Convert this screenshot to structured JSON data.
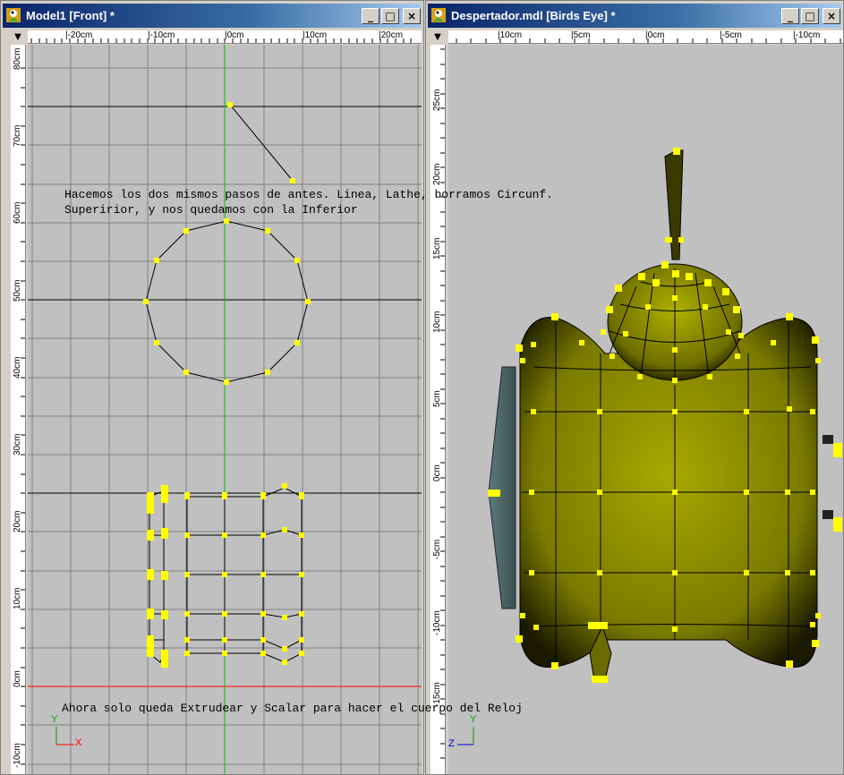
{
  "left_window": {
    "title": "Model1 [Front] *",
    "h_ruler": [
      "|-20cm",
      "|-10cm",
      "|0cm",
      "|10cm",
      "|20cm"
    ],
    "v_ruler": [
      "80cm",
      "70cm",
      "60cm",
      "50cm",
      "40cm",
      "30cm",
      "20cm",
      "10cm",
      "0cm",
      "-10cm"
    ],
    "note_top_line1": "Hacemos los dos mismos pasos de antes. Linea, Lathe, borramos Circunf.",
    "note_top_line2": "Superirior, y nos quedamos con la Inferior",
    "note_bottom": "Ahora solo queda Extrudear y Scalar para hacer el cuerpo del Reloj",
    "axis_y": "Y",
    "axis_x": "X"
  },
  "right_window": {
    "title": "Despertador.mdl [Birds Eye] *",
    "h_ruler": [
      "|10cm",
      "|5cm",
      "|0cm",
      "|-5cm",
      "|-10cm"
    ],
    "v_ruler": [
      "25cm",
      "20cm",
      "15cm",
      "10cm",
      "5cm",
      "0cm",
      "-5cm",
      "-10cm",
      "-15cm"
    ],
    "axis_y": "Y",
    "axis_z": "Z"
  },
  "buttons": {
    "minimize": "_",
    "maximize": "□",
    "close": "×",
    "menu": "▼"
  },
  "colors": {
    "titlebar": "#0a246a",
    "viewport_bg": "#c0c0c0",
    "grid": "#808080",
    "vertex": "#ffff00",
    "model_fill": "#8b8b00",
    "axis_green": "#00c000",
    "axis_red": "#ff0000"
  }
}
